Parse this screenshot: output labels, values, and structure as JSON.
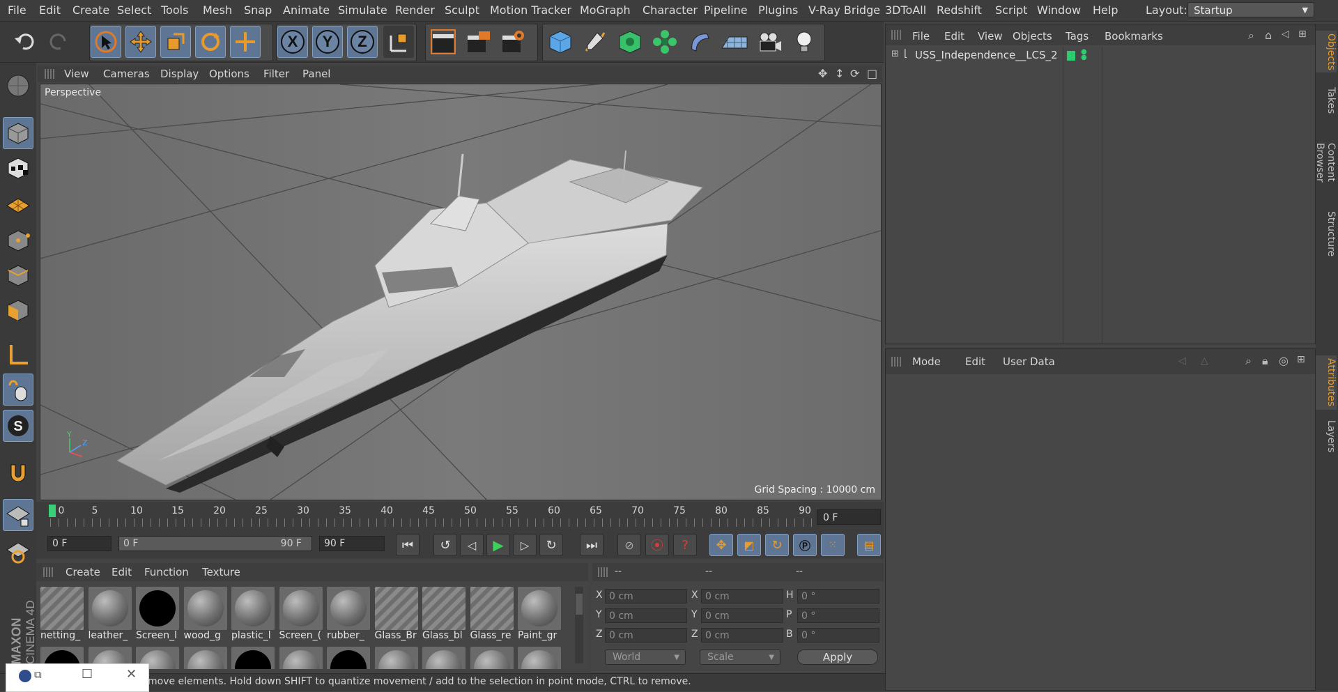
{
  "menubar": {
    "items": [
      "File",
      "Edit",
      "Create",
      "Select",
      "Tools",
      "Mesh",
      "Snap",
      "Animate",
      "Simulate",
      "Render",
      "Sculpt",
      "Motion Tracker",
      "MoGraph",
      "Character",
      "Pipeline",
      "Plugins",
      "V-Ray Bridge",
      "3DToAll",
      "Redshift",
      "Script",
      "Window",
      "Help"
    ],
    "layout_label": "Layout:",
    "layout_value": "Startup"
  },
  "toolbar": {
    "axis_x": "X",
    "axis_y": "Y",
    "axis_z": "Z"
  },
  "viewport": {
    "menu": [
      "View",
      "Cameras",
      "Display",
      "Options",
      "Filter",
      "Panel"
    ],
    "label": "Perspective",
    "grid_spacing": "Grid Spacing : 10000 cm",
    "axis_labels": {
      "y": "Y",
      "z": "Z",
      "x": "X"
    }
  },
  "timeline": {
    "ticks": [
      "0",
      "5",
      "10",
      "15",
      "20",
      "25",
      "30",
      "35",
      "40",
      "45",
      "50",
      "55",
      "60",
      "65",
      "70",
      "75",
      "80",
      "85",
      "90"
    ],
    "current_frame": "0 F"
  },
  "transport": {
    "start_frame": "0 F",
    "range_start": "0 F",
    "range_end": "90 F",
    "end_frame": "90 F"
  },
  "materials": {
    "menu": [
      "Create",
      "Edit",
      "Function",
      "Texture"
    ],
    "row1": [
      {
        "label": "netting_",
        "kind": "glass"
      },
      {
        "label": "leather_",
        "kind": "sphere"
      },
      {
        "label": "Screen_l",
        "kind": "black"
      },
      {
        "label": "wood_g",
        "kind": "sphere"
      },
      {
        "label": "plastic_l",
        "kind": "sphere"
      },
      {
        "label": "Screen_(",
        "kind": "sphere"
      },
      {
        "label": "rubber_",
        "kind": "sphere"
      },
      {
        "label": "Glass_Br",
        "kind": "glass"
      },
      {
        "label": "Glass_bl",
        "kind": "glass"
      },
      {
        "label": "Glass_re",
        "kind": "glass"
      },
      {
        "label": "Paint_gr",
        "kind": "sphere"
      }
    ]
  },
  "coordinates": {
    "header": [
      "--",
      "--",
      "--"
    ],
    "rows": [
      {
        "l1": "X",
        "v1": "0 cm",
        "l2": "X",
        "v2": "0 cm",
        "l3": "H",
        "v3": "0 °"
      },
      {
        "l1": "Y",
        "v1": "0 cm",
        "l2": "Y",
        "v2": "0 cm",
        "l3": "P",
        "v3": "0 °"
      },
      {
        "l1": "Z",
        "v1": "0 cm",
        "l2": "Z",
        "v2": "0 cm",
        "l3": "B",
        "v3": "0 °"
      }
    ],
    "space": "World",
    "mode": "Scale",
    "apply": "Apply"
  },
  "objects": {
    "menu": [
      "File",
      "Edit",
      "View",
      "Objects",
      "Tags",
      "Bookmarks"
    ],
    "items": [
      {
        "name": "USS_Independence__LCS_2"
      }
    ]
  },
  "attributes": {
    "menu": [
      "Mode",
      "Edit",
      "User Data"
    ]
  },
  "sidetabs": {
    "top": [
      "Objects",
      "Takes",
      "Content Browser",
      "Structure"
    ],
    "bottom": [
      "Attributes",
      "Layers"
    ]
  },
  "status": {
    "text": "move elements. Hold down SHIFT to quantize movement / add to the selection in point mode, CTRL to remove."
  },
  "brand": {
    "line1": "MAXON",
    "line2": "CINEMA 4D"
  },
  "colors": {
    "accent": "#5e7693",
    "highlight": "#e79b2a",
    "object_tag": "#2ecc71"
  }
}
